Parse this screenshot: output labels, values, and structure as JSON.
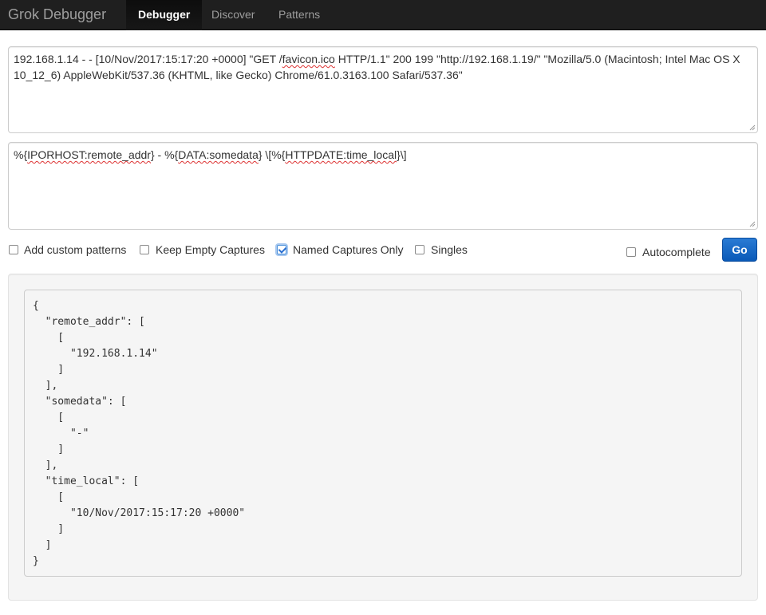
{
  "navbar": {
    "brand": "Grok Debugger",
    "tabs": [
      {
        "label": "Debugger",
        "active": true
      },
      {
        "label": "Discover",
        "active": false
      },
      {
        "label": "Patterns",
        "active": false
      }
    ]
  },
  "input": {
    "sample_pre": "192.168.1.14 - - [10/Nov/2017:15:17:20 +0000] \"GET /",
    "sample_word": "favicon.ico",
    "sample_post": " HTTP/1.1\" 200 199 \"http://192.168.1.19/\" \"Mozilla/5.0 (Macintosh; Intel Mac OS X 10_12_6) AppleWebKit/537.36 (KHTML, like Gecko) Chrome/61.0.3163.100 Safari/537.36\""
  },
  "pattern": {
    "p1": "%{",
    "p2": "IPORHOST:remote_addr",
    "p3": "} - %{",
    "p4": "DATA:somedata",
    "p5": "} \\[%{",
    "p6": "HTTPDATE:time_local",
    "p7": "}\\]"
  },
  "options": {
    "add_custom_patterns": {
      "label": "Add custom patterns",
      "checked": false
    },
    "keep_empty_captures": {
      "label": "Keep Empty Captures",
      "checked": false
    },
    "named_captures_only": {
      "label": "Named Captures Only",
      "checked": true
    },
    "singles": {
      "label": "Singles",
      "checked": false
    },
    "autocomplete": {
      "label": "Autocomplete",
      "checked": false
    }
  },
  "go_label": "Go",
  "output": "{\n  \"remote_addr\": [\n    [\n      \"192.168.1.14\"\n    ]\n  ],\n  \"somedata\": [\n    [\n      \"-\"\n    ]\n  ],\n  \"time_local\": [\n    [\n      \"10/Nov/2017:15:17:20 +0000\"\n    ]\n  ]\n}",
  "colors": {
    "navbar_bg": "#1f1f1f",
    "primary_button": "#0a59b8",
    "spellcheck_underline": "#dd3333"
  }
}
